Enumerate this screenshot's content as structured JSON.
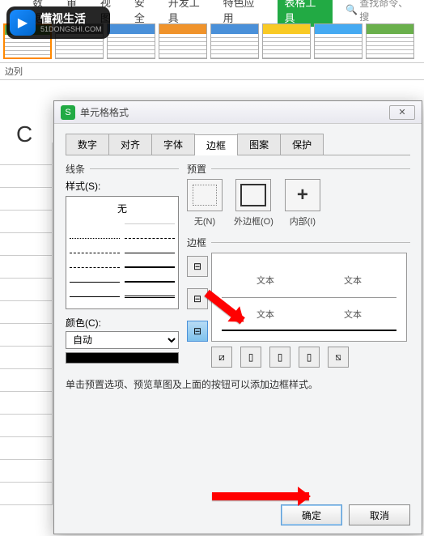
{
  "watermark": {
    "title": "懂视生活",
    "sub": "51DONGSHI.COM",
    "play": "▶"
  },
  "ribbon": {
    "tabs": [
      "数据",
      "审阅",
      "视图",
      "安全",
      "开发工具",
      "特色应用",
      "表格工具"
    ],
    "search_icon_label": "🔍",
    "search": "查找命令、搜"
  },
  "side_label": "边列",
  "col_header": "C",
  "dialog": {
    "title": "单元格格式",
    "icon": "S",
    "close": "✕",
    "tabs": [
      "数字",
      "对齐",
      "字体",
      "边框",
      "图案",
      "保护"
    ],
    "lines": {
      "group": "线条",
      "style": "样式(S):",
      "none": "无",
      "color": "颜色(C):",
      "auto": "自动"
    },
    "preset": {
      "group": "预置",
      "none": "无(N)",
      "outer": "外边框(O)",
      "inner": "内部(I)"
    },
    "border": {
      "group": "边框",
      "sample": "文本"
    },
    "hint": "单击预置选项、预览草图及上面的按钮可以添加边框样式。",
    "ok": "确定",
    "cancel": "取消"
  }
}
